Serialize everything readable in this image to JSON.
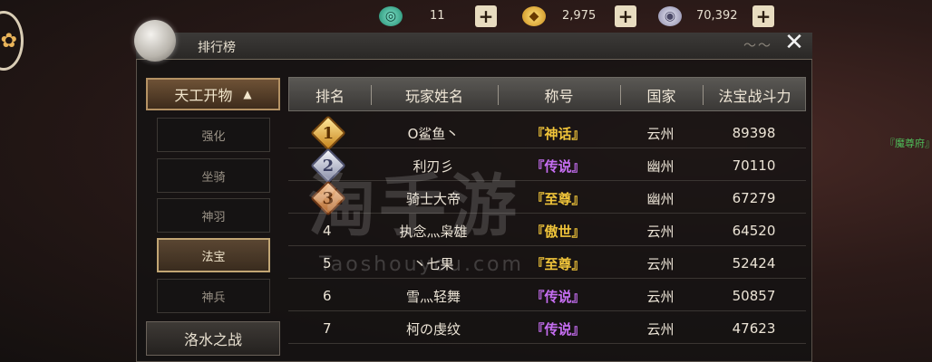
{
  "currency": [
    {
      "icon": "jade-coin-icon",
      "value": "11",
      "class": "jade"
    },
    {
      "icon": "gold-ingot-icon",
      "value": "2,975",
      "class": "gold"
    },
    {
      "icon": "silver-coin-icon",
      "value": "70,392",
      "class": "silver"
    }
  ],
  "panel": {
    "title": "排行榜"
  },
  "side_menu": {
    "category": "天工开物",
    "items": [
      "强化",
      "坐骑",
      "神羽",
      "法宝",
      "神兵"
    ],
    "active_item": "法宝",
    "category2": "洛水之战"
  },
  "table": {
    "headers": [
      "排名",
      "玩家姓名",
      "称号",
      "国家",
      "法宝战斗力"
    ],
    "rows": [
      {
        "rank": "1",
        "name": "O鲨鱼丶",
        "title": "『神话』",
        "country": "云州",
        "power": "89398"
      },
      {
        "rank": "2",
        "name": "利刃彡",
        "title": "『传说』",
        "country": "幽州",
        "power": "70110"
      },
      {
        "rank": "3",
        "name": "骑士大帝",
        "title": "『至尊』",
        "country": "幽州",
        "power": "67279"
      },
      {
        "rank": "4",
        "name": "执念灬枭雄",
        "title": "『傲世』",
        "country": "云州",
        "power": "64520"
      },
      {
        "rank": "5",
        "name": "丶七果",
        "title": "『至尊』",
        "country": "云州",
        "power": "52424"
      },
      {
        "rank": "6",
        "name": "雪灬轻舞",
        "title": "『传说』",
        "country": "云州",
        "power": "50857"
      },
      {
        "rank": "7",
        "name": "柯の虔纹",
        "title": "『传说』",
        "country": "云州",
        "power": "47623"
      }
    ]
  },
  "colors": {
    "title_mythic": "#f0c43a",
    "title_legend": "#c66ef2",
    "title_supreme": "#f0c43a",
    "title_proud": "#f0c43a"
  },
  "watermark": {
    "main": "淘手游",
    "sub": "Taoshouyou.com"
  },
  "bg_text": "『魔尊府』"
}
